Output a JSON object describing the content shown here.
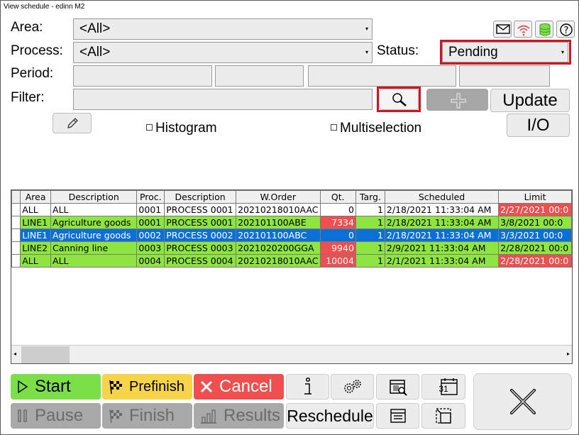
{
  "window": {
    "title": "View schedule - edinn M2"
  },
  "filters": {
    "area_label": "Area:",
    "area_value": "<All>",
    "process_label": "Process:",
    "process_value": "<All>",
    "status_label": "Status:",
    "status_value": "Pending",
    "period_label": "Period:",
    "filter_label": "Filter:",
    "update_label": "Update",
    "io_label": "I/O",
    "histogram_label": "Histogram",
    "multiselection_label": "Multiselection"
  },
  "table": {
    "columns": [
      "Area",
      "Description",
      "Proc.",
      "Description",
      "W.Order",
      "Qt.",
      "Targ.",
      "Scheduled",
      "Limit"
    ],
    "rows": [
      {
        "style": "white",
        "cells": [
          "ALL",
          "ALL",
          "0001",
          "PROCESS 0001",
          "20210218010AAC",
          "0",
          "1",
          "2/18/2021 11:33:04 AM",
          "2/27/2021 00:0"
        ],
        "red": [
          8
        ]
      },
      {
        "style": "green",
        "cells": [
          "LINE1",
          "Agriculture goods",
          "0001",
          "PROCESS 0001",
          "202101100ABE",
          "7334",
          "1",
          "2/18/2021 11:33:04 AM",
          "3/8/2021 00:0"
        ],
        "red": [
          5
        ]
      },
      {
        "style": "blue",
        "cells": [
          "LINE1",
          "Agriculture goods",
          "0002",
          "PROCESS 0002",
          "202101100ABC",
          "0",
          "1",
          "2/18/2021 11:33:04 AM",
          "3/3/2021 00:0"
        ],
        "red": []
      },
      {
        "style": "green",
        "cells": [
          "LINE2",
          "Canning line",
          "0003",
          "PROCESS 0003",
          "2021020200GGA",
          "9940",
          "1",
          "2/9/2021 11:33:04 AM",
          "2/28/2021 00:0"
        ],
        "red": [
          5
        ]
      },
      {
        "style": "green",
        "cells": [
          "ALL",
          "ALL",
          "0004",
          "PROCESS 0004",
          "20210218010AAC",
          "10004",
          "1",
          "2/1/2021 11:33:04 AM",
          "2/28/2021 00:0"
        ],
        "red": [
          5,
          8
        ]
      }
    ]
  },
  "actions": {
    "start": "Start",
    "prefinish": "Prefinish",
    "cancel": "Cancel",
    "pause": "Pause",
    "finish": "Finish",
    "results": "Results",
    "reschedule": "Reschedule",
    "calendar_day": "31"
  },
  "colors": {
    "highlight_red": "#d0161f",
    "row_green": "#8ee53f",
    "row_blue": "#0a6fd6",
    "cell_red": "#ef4f4f",
    "start_green": "#7bdf47",
    "prefinish_yellow": "#f7d449"
  }
}
